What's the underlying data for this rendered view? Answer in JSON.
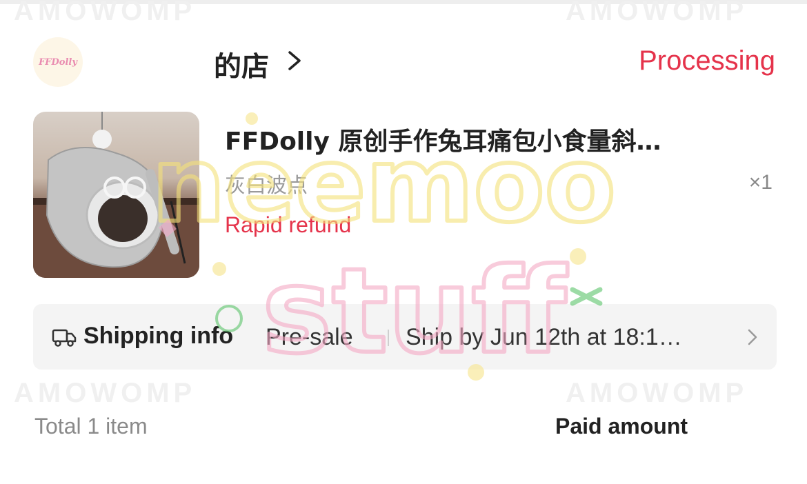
{
  "order": {
    "store": {
      "name": "的店",
      "logo_text": "FFDolly",
      "chevron_icon": "chevron-right-icon"
    },
    "status": "Processing",
    "item": {
      "title": "FFDolly 原创手作兔耳痛包小食量斜…",
      "variant": "灰白波点",
      "quantity": "×1",
      "refund_tag": "Rapid refund"
    },
    "shipping": {
      "icon": "truck-icon",
      "label": "Shipping info",
      "type": "Pre-sale",
      "eta": "Ship by Jun 12th at 18:1…"
    },
    "summary": {
      "total": "Total 1 item",
      "paid_label": "Paid amount"
    }
  },
  "watermark": {
    "line1": "neemoo",
    "line2": "stuff"
  },
  "colors": {
    "accent_red": "#e5334b",
    "bar_bg": "#f4f4f4"
  }
}
